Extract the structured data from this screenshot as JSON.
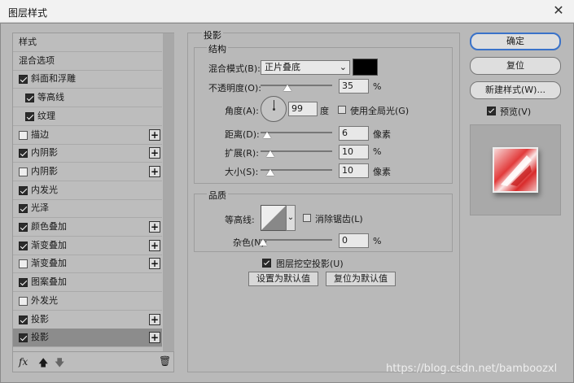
{
  "window": {
    "title": "图层样式"
  },
  "styles_list": [
    {
      "label": "样式",
      "checkbox": false,
      "checked": false,
      "plus": false,
      "indent": 0
    },
    {
      "label": "混合选项",
      "checkbox": false,
      "checked": false,
      "plus": false,
      "indent": 0
    },
    {
      "label": "斜面和浮雕",
      "checkbox": true,
      "checked": true,
      "plus": false,
      "indent": 0
    },
    {
      "label": "等高线",
      "checkbox": true,
      "checked": true,
      "plus": false,
      "indent": 1
    },
    {
      "label": "纹理",
      "checkbox": true,
      "checked": true,
      "plus": false,
      "indent": 1
    },
    {
      "label": "描边",
      "checkbox": true,
      "checked": false,
      "plus": true,
      "indent": 0
    },
    {
      "label": "内阴影",
      "checkbox": true,
      "checked": true,
      "plus": true,
      "indent": 0
    },
    {
      "label": "内阴影",
      "checkbox": true,
      "checked": false,
      "plus": true,
      "indent": 0
    },
    {
      "label": "内发光",
      "checkbox": true,
      "checked": true,
      "plus": false,
      "indent": 0
    },
    {
      "label": "光泽",
      "checkbox": true,
      "checked": true,
      "plus": false,
      "indent": 0
    },
    {
      "label": "颜色叠加",
      "checkbox": true,
      "checked": true,
      "plus": true,
      "indent": 0
    },
    {
      "label": "渐变叠加",
      "checkbox": true,
      "checked": true,
      "plus": true,
      "indent": 0
    },
    {
      "label": "渐变叠加",
      "checkbox": true,
      "checked": false,
      "plus": true,
      "indent": 0
    },
    {
      "label": "图案叠加",
      "checkbox": true,
      "checked": true,
      "plus": false,
      "indent": 0
    },
    {
      "label": "外发光",
      "checkbox": true,
      "checked": false,
      "plus": false,
      "indent": 0
    },
    {
      "label": "投影",
      "checkbox": true,
      "checked": true,
      "plus": true,
      "indent": 0
    },
    {
      "label": "投影",
      "checkbox": true,
      "checked": true,
      "plus": true,
      "indent": 0,
      "selected": true
    }
  ],
  "panel": {
    "title": "投影",
    "structure_title": "结构",
    "blend_mode_label": "混合模式(B):",
    "blend_mode_value": "正片叠底",
    "shadow_color": "#000000",
    "opacity_label": "不透明度(O):",
    "opacity_value": "35",
    "opacity_unit": "%",
    "angle_label": "角度(A):",
    "angle_value": "99",
    "angle_unit": "度",
    "global_light_label": "使用全局光(G)",
    "global_light_checked": false,
    "distance_label": "距离(D):",
    "distance_value": "6",
    "distance_unit": "像素",
    "spread_label": "扩展(R):",
    "spread_value": "10",
    "spread_unit": "%",
    "size_label": "大小(S):",
    "size_value": "10",
    "size_unit": "像素",
    "quality_title": "品质",
    "contour_label": "等高线:",
    "antialias_label": "消除锯齿(L)",
    "antialias_checked": false,
    "noise_label": "杂色(N):",
    "noise_value": "0",
    "noise_unit": "%",
    "knockout_label": "图层挖空投影(U)",
    "knockout_checked": true,
    "set_default_label": "设置为默认值",
    "reset_default_label": "复位为默认值"
  },
  "buttons": {
    "ok": "确定",
    "reset": "复位",
    "new_style": "新建样式(W)...",
    "preview_label": "预览(V)",
    "preview_checked": true
  },
  "bottom_bar": {
    "fx_label": "fx"
  },
  "watermark": "https://blog.csdn.net/bamboozxl"
}
